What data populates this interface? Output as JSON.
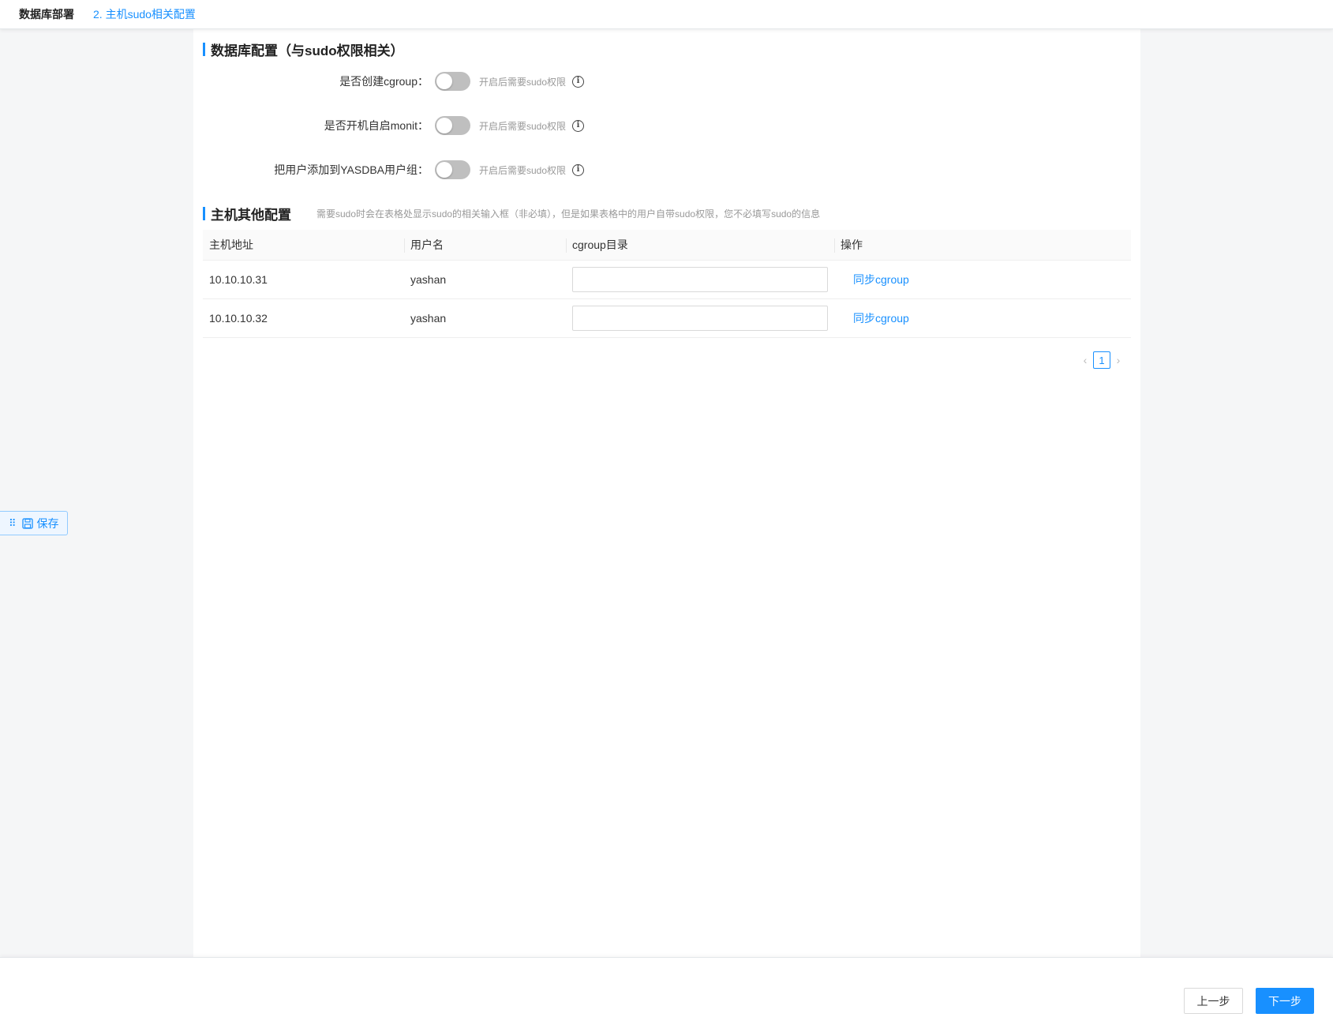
{
  "breadcrumb": {
    "root": "数据库部署",
    "current": "2. 主机sudo相关配置"
  },
  "db_section": {
    "title": "数据库配置（与sudo权限相关）",
    "rows": [
      {
        "label": "是否创建cgroup：",
        "enabled": false,
        "hint": "开启后需要sudo权限"
      },
      {
        "label": "是否开机自启monit：",
        "enabled": false,
        "hint": "开启后需要sudo权限"
      },
      {
        "label": "把用户添加到YASDBA用户组：",
        "enabled": false,
        "hint": "开启后需要sudo权限"
      }
    ]
  },
  "host_section": {
    "title": "主机其他配置",
    "hint": "需要sudo时会在表格处显示sudo的相关输入框（非必填），但是如果表格中的用户自带sudo权限，您不必填写sudo的信息"
  },
  "table": {
    "headers": [
      "主机地址",
      "用户名",
      "cgroup目录",
      "操作"
    ],
    "rows": [
      {
        "host": "10.10.10.31",
        "user": "yashan",
        "cgroup_dir": "",
        "action": "同步cgroup"
      },
      {
        "host": "10.10.10.32",
        "user": "yashan",
        "cgroup_dir": "",
        "action": "同步cgroup"
      }
    ]
  },
  "pagination": {
    "prev": "<",
    "current_page": "1",
    "next": ">"
  },
  "float_save": {
    "drag_handle": "⠿",
    "label": "保存",
    "icon": "save-icon"
  },
  "footer": {
    "prev_label": "上一步",
    "next_label": "下一步"
  },
  "colors": {
    "accent": "#1890ff",
    "switch_off": "#bfbfbf"
  }
}
